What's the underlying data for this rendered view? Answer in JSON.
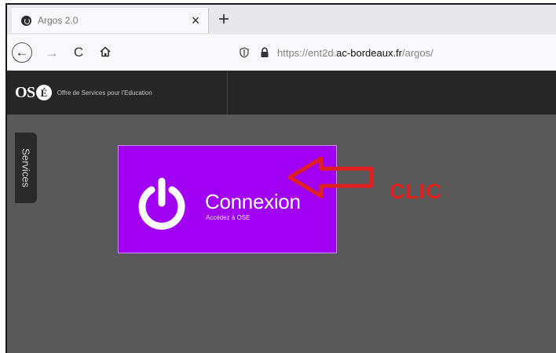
{
  "browser": {
    "tab": {
      "title": "Argos 2.0",
      "close": "×"
    },
    "new_tab": "+",
    "nav": {
      "back": "←",
      "forward": "→",
      "reload": "C"
    },
    "url": {
      "prefix": "https://ent2d.",
      "host": "ac-bordeaux.fr",
      "path": "/argos/"
    }
  },
  "header": {
    "logo_text": "OS",
    "logo_e": "É",
    "tagline": "Offre de Services pour l'Education"
  },
  "sidebar": {
    "services_label": "Services"
  },
  "login_tile": {
    "label": "Connexion",
    "sublabel": "Accédez à OSE",
    "color": "#a100f2"
  },
  "annotation": {
    "text": "CLIC",
    "color": "#e0201e"
  },
  "icons": {
    "tab_favicon": "argos-logo-icon",
    "home": "home-icon",
    "shield": "shield-icon",
    "lock": "lock-icon",
    "power": "power-icon",
    "annotation_arrow": "arrow-left-icon"
  }
}
